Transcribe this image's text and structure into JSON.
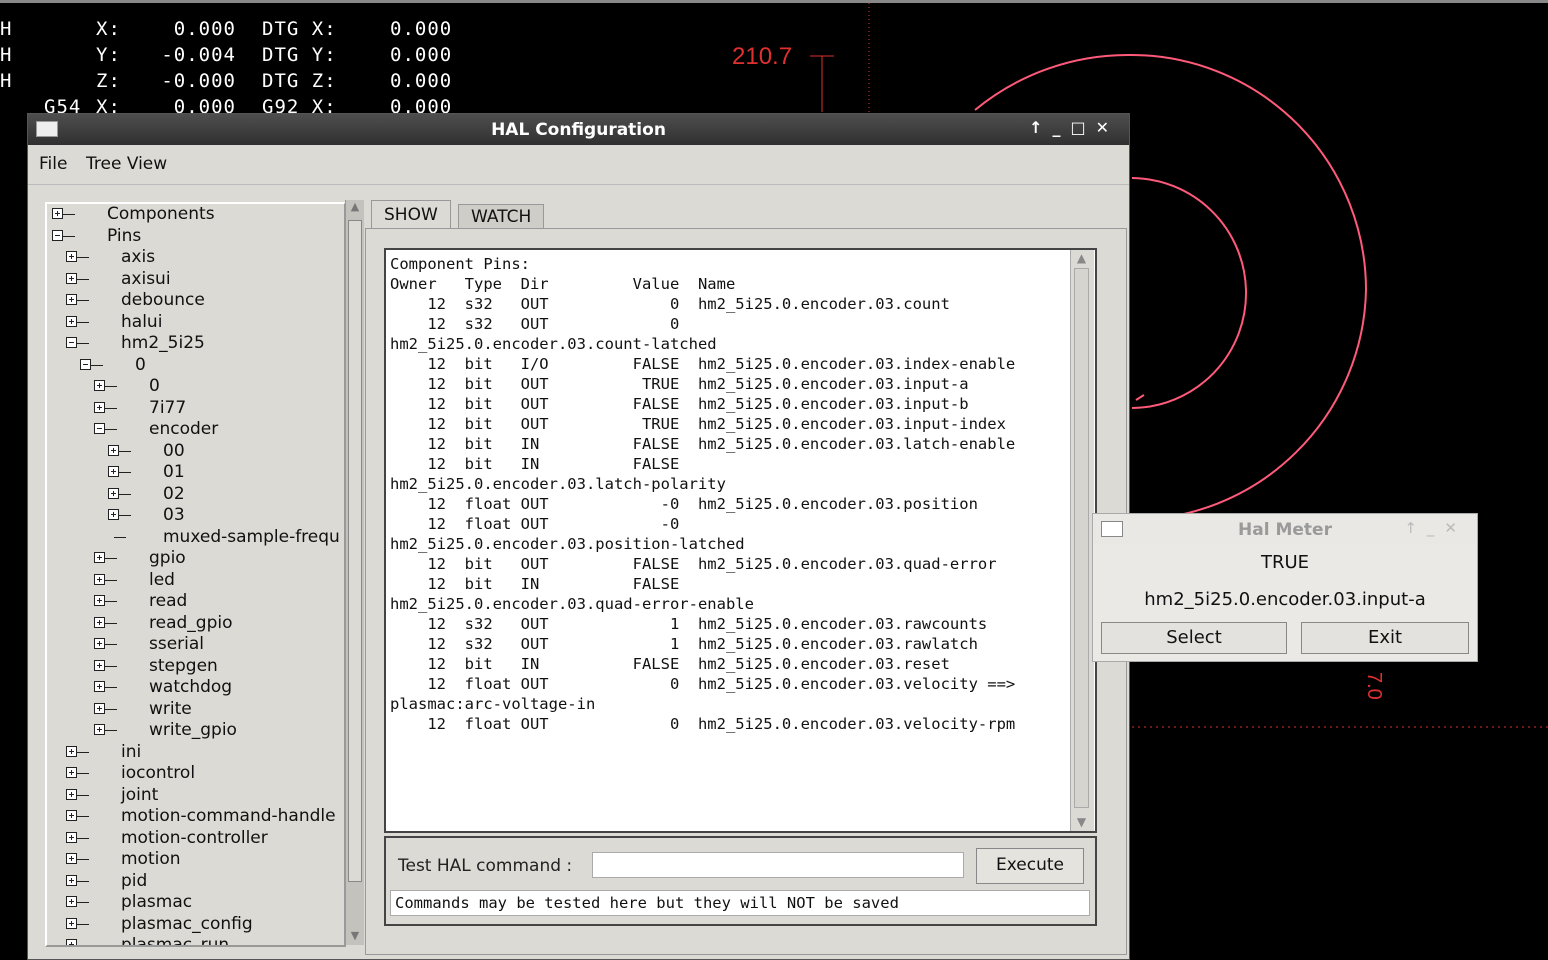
{
  "dro": {
    "rows": [
      {
        "prefix": "H",
        "axis": "X:",
        "value": "0.000",
        "dtg_label": "DTG X:",
        "dtg_value": "0.000"
      },
      {
        "prefix": "H",
        "axis": "Y:",
        "value": "-0.004",
        "dtg_label": "DTG Y:",
        "dtg_value": "0.000"
      },
      {
        "prefix": "H",
        "axis": "Z:",
        "value": "-0.000",
        "dtg_label": "DTG Z:",
        "dtg_value": "0.000"
      },
      {
        "prefix": "G54",
        "axis": "X:",
        "value": "0.000",
        "dtg_label": "G92 X:",
        "dtg_value": "0.000"
      }
    ]
  },
  "plot": {
    "dimension_label": "210.7",
    "dimension_label_2": "7.0",
    "accent_color": "#ff5a7a",
    "dim_color": "#e03030"
  },
  "hal_window": {
    "title": "HAL Configuration",
    "menu": [
      "File",
      "Tree View"
    ],
    "tree": [
      {
        "label": "Components",
        "level": 0,
        "expanded": false
      },
      {
        "label": "Pins",
        "level": 0,
        "expanded": true
      },
      {
        "label": "axis",
        "level": 1,
        "expanded": false
      },
      {
        "label": "axisui",
        "level": 1,
        "expanded": false
      },
      {
        "label": "debounce",
        "level": 1,
        "expanded": false
      },
      {
        "label": "halui",
        "level": 1,
        "expanded": false
      },
      {
        "label": "hm2_5i25",
        "level": 1,
        "expanded": true
      },
      {
        "label": "0",
        "level": 2,
        "expanded": true
      },
      {
        "label": "0",
        "level": 3,
        "expanded": false
      },
      {
        "label": "7i77",
        "level": 3,
        "expanded": false
      },
      {
        "label": "encoder",
        "level": 3,
        "expanded": true
      },
      {
        "label": "00",
        "level": 4,
        "expanded": false
      },
      {
        "label": "01",
        "level": 4,
        "expanded": false
      },
      {
        "label": "02",
        "level": 4,
        "expanded": false
      },
      {
        "label": "03",
        "level": 4,
        "expanded": false
      },
      {
        "label": "muxed-sample-frequ",
        "level": 4,
        "leaf": true
      },
      {
        "label": "gpio",
        "level": 3,
        "expanded": false
      },
      {
        "label": "led",
        "level": 3,
        "expanded": false
      },
      {
        "label": "read",
        "level": 3,
        "expanded": false
      },
      {
        "label": "read_gpio",
        "level": 3,
        "expanded": false
      },
      {
        "label": "sserial",
        "level": 3,
        "expanded": false
      },
      {
        "label": "stepgen",
        "level": 3,
        "expanded": false
      },
      {
        "label": "watchdog",
        "level": 3,
        "expanded": false
      },
      {
        "label": "write",
        "level": 3,
        "expanded": false
      },
      {
        "label": "write_gpio",
        "level": 3,
        "expanded": false
      },
      {
        "label": "ini",
        "level": 1,
        "expanded": false
      },
      {
        "label": "iocontrol",
        "level": 1,
        "expanded": false
      },
      {
        "label": "joint",
        "level": 1,
        "expanded": false
      },
      {
        "label": "motion-command-handle",
        "level": 1,
        "expanded": false
      },
      {
        "label": "motion-controller",
        "level": 1,
        "expanded": false
      },
      {
        "label": "motion",
        "level": 1,
        "expanded": false
      },
      {
        "label": "pid",
        "level": 1,
        "expanded": false
      },
      {
        "label": "plasmac",
        "level": 1,
        "expanded": false
      },
      {
        "label": "plasmac_config",
        "level": 1,
        "expanded": false
      },
      {
        "label": "plasmac_run",
        "level": 1,
        "expanded": false
      }
    ],
    "tabs": [
      "SHOW",
      "WATCH"
    ],
    "show_lines": [
      "Component Pins:",
      "Owner   Type  Dir         Value  Name",
      "    12  s32   OUT             0  hm2_5i25.0.encoder.03.count",
      "    12  s32   OUT             0",
      "hm2_5i25.0.encoder.03.count-latched",
      "    12  bit   I/O         FALSE  hm2_5i25.0.encoder.03.index-enable",
      "    12  bit   OUT          TRUE  hm2_5i25.0.encoder.03.input-a",
      "    12  bit   OUT         FALSE  hm2_5i25.0.encoder.03.input-b",
      "    12  bit   OUT          TRUE  hm2_5i25.0.encoder.03.input-index",
      "    12  bit   IN          FALSE  hm2_5i25.0.encoder.03.latch-enable",
      "    12  bit   IN          FALSE",
      "hm2_5i25.0.encoder.03.latch-polarity",
      "    12  float OUT            -0  hm2_5i25.0.encoder.03.position",
      "    12  float OUT            -0",
      "hm2_5i25.0.encoder.03.position-latched",
      "    12  bit   OUT         FALSE  hm2_5i25.0.encoder.03.quad-error",
      "    12  bit   IN          FALSE",
      "hm2_5i25.0.encoder.03.quad-error-enable",
      "    12  s32   OUT             1  hm2_5i25.0.encoder.03.rawcounts",
      "    12  s32   OUT             1  hm2_5i25.0.encoder.03.rawlatch",
      "    12  bit   IN          FALSE  hm2_5i25.0.encoder.03.reset",
      "    12  float OUT             0  hm2_5i25.0.encoder.03.velocity ==>",
      "plasmac:arc-voltage-in",
      "    12  float OUT             0  hm2_5i25.0.encoder.03.velocity-rpm"
    ],
    "command": {
      "label": "Test HAL command :",
      "value": "",
      "execute_label": "Execute",
      "message": "Commands may be tested here but they will NOT be saved"
    }
  },
  "hal_meter": {
    "title": "Hal Meter",
    "value": "TRUE",
    "pin": "hm2_5i25.0.encoder.03.input-a",
    "select_label": "Select",
    "exit_label": "Exit"
  }
}
